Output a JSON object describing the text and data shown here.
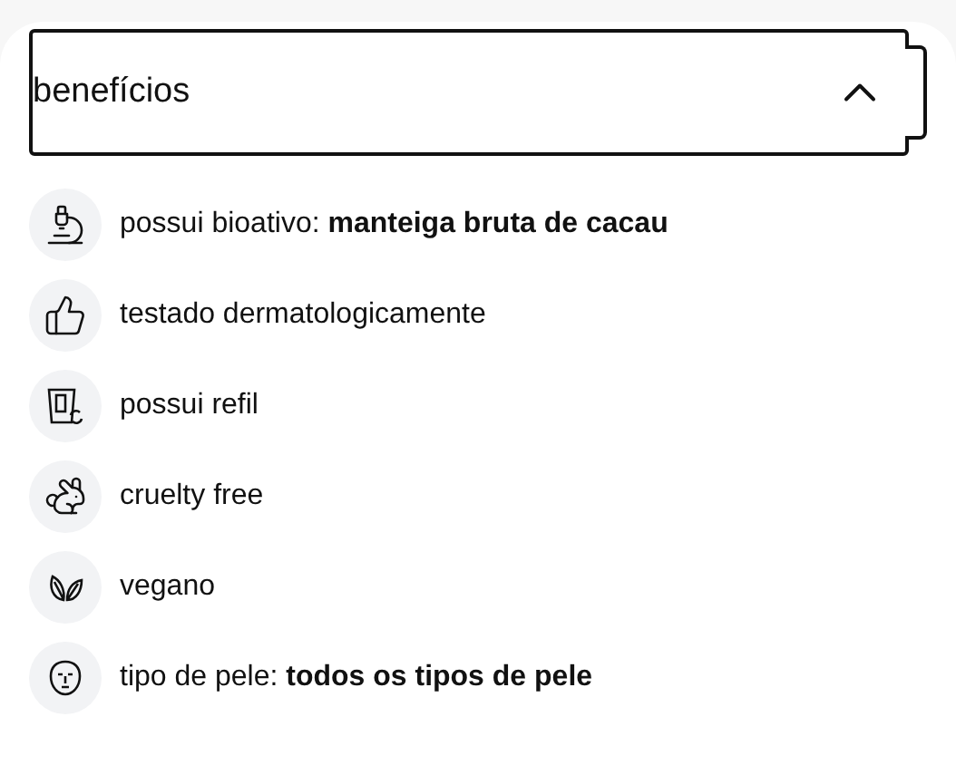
{
  "accordion": {
    "title": "benefícios",
    "expanded": true,
    "items": [
      {
        "kind": "microscope",
        "text": "possui bioativo: **manteiga bruta de cacau**"
      },
      {
        "kind": "thumbs-up",
        "text": "testado dermatologicamente"
      },
      {
        "kind": "refill",
        "text": "possui refil"
      },
      {
        "kind": "rabbit",
        "text": "cruelty free"
      },
      {
        "kind": "leaves",
        "text": "vegano"
      },
      {
        "kind": "face",
        "text": "tipo de pele: **todos os tipos de pele**"
      }
    ]
  }
}
